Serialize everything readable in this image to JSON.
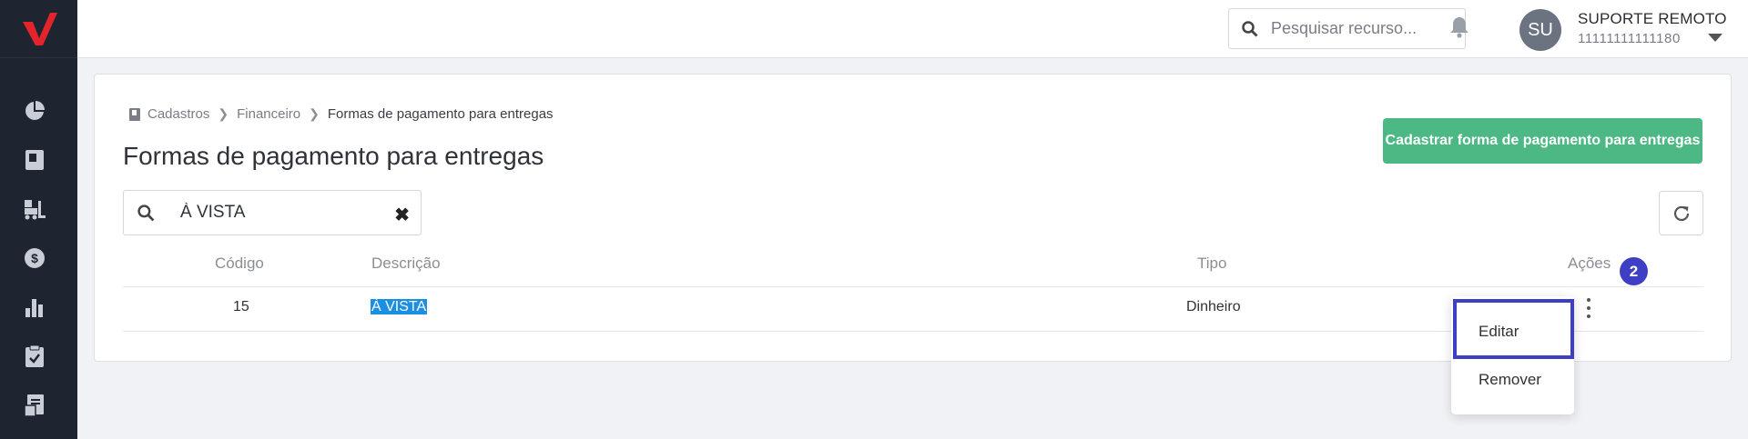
{
  "header": {
    "search_placeholder": "Pesquisar recurso...",
    "user": {
      "initials": "SU",
      "name": "SUPORTE REMOTO",
      "id": "11111111111180"
    }
  },
  "sidebar": {
    "items": [
      {
        "icon": "pie-chart-icon"
      },
      {
        "icon": "book-icon"
      },
      {
        "icon": "forklift-icon"
      },
      {
        "icon": "dollar-icon"
      },
      {
        "icon": "bar-chart-icon"
      },
      {
        "icon": "clipboard-icon"
      },
      {
        "icon": "document-icon"
      }
    ]
  },
  "breadcrumb": {
    "items": [
      "Cadastros",
      "Financeiro",
      "Formas de pagamento para entregas"
    ]
  },
  "page": {
    "title": "Formas de pagamento para entregas",
    "primary_button": "Cadastrar forma de pagamento para entregas",
    "filter_value": "À VISTA"
  },
  "table": {
    "headers": [
      "Código",
      "Descrição",
      "Tipo",
      "Ações"
    ],
    "rows": [
      {
        "codigo": "15",
        "descricao": "À VISTA",
        "tipo": "Dinheiro"
      }
    ]
  },
  "annotation": {
    "step": "2"
  },
  "menu": {
    "items": [
      "Editar",
      "Remover"
    ]
  },
  "colors": {
    "sidebar": "#1e2530",
    "primary": "#4cb884",
    "highlight": "#1a8fe3",
    "focus": "#3f3fc5",
    "brand": "#e4242b"
  }
}
